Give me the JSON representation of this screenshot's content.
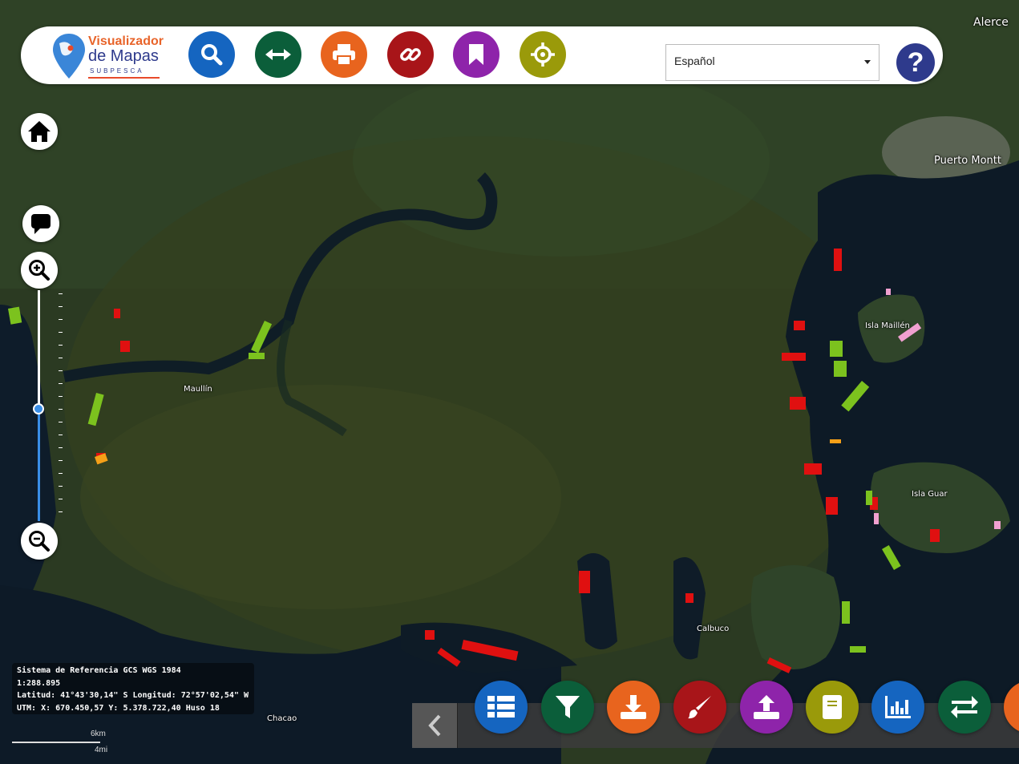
{
  "header": {
    "logo": {
      "line1": "Visualizador",
      "line2": "de Mapas",
      "line3": "SUBPESCA"
    },
    "tools": [
      {
        "name": "search",
        "icon": "search-icon",
        "color": "#1565c0"
      },
      {
        "name": "measure",
        "icon": "arrows-horizontal-icon",
        "color": "#0b5e3a"
      },
      {
        "name": "print",
        "icon": "printer-icon",
        "color": "#e8641e"
      },
      {
        "name": "share-link",
        "icon": "link-icon",
        "color": "#a81519"
      },
      {
        "name": "bookmark",
        "icon": "bookmark-icon",
        "color": "#8e24aa"
      },
      {
        "name": "locate",
        "icon": "crosshair-icon",
        "color": "#9a9a0a"
      }
    ],
    "language": {
      "selected": "Español"
    },
    "help": {
      "label": "?",
      "color": "#2e3a8c"
    }
  },
  "map_controls": {
    "home": "home-icon",
    "comment": "comment-icon",
    "zoom_in": "zoom-in-icon",
    "zoom_out": "zoom-out-icon",
    "zoom_level_fraction": 0.48
  },
  "place_labels": {
    "alerce": "Alerce",
    "puerto_montt": "Puerto Montt",
    "isla_maillen": "Isla Maillén",
    "maullin": "Maullín",
    "isla_guar": "Isla Guar",
    "calbuco": "Calbuco",
    "chacao": "Chacao"
  },
  "coordinates": {
    "line1": "Sistema de Referencia GCS WGS 1984",
    "line2": "1:288.895",
    "line3": "Latitud: 41°43'30,14\" S  Longitud: 72°57'02,54\" W",
    "line4": "UTM: X: 670.450,57  Y: 5.378.722,40  Huso 18"
  },
  "scale": {
    "km": "6km",
    "mi": "4mi"
  },
  "bottom_tools": [
    {
      "name": "layers-list",
      "icon": "table-list-icon",
      "color": "#1565c0"
    },
    {
      "name": "filter",
      "icon": "filter-icon",
      "color": "#0b5e3a"
    },
    {
      "name": "download",
      "icon": "download-icon",
      "color": "#e8641e"
    },
    {
      "name": "draw",
      "icon": "paintbrush-icon",
      "color": "#a81519"
    },
    {
      "name": "upload",
      "icon": "upload-icon",
      "color": "#8e24aa"
    },
    {
      "name": "book",
      "icon": "book-icon",
      "color": "#9a9a0a"
    },
    {
      "name": "chart",
      "icon": "bar-chart-icon",
      "color": "#1565c0"
    },
    {
      "name": "swap",
      "icon": "swap-icon",
      "color": "#0b5e3a"
    },
    {
      "name": "more",
      "icon": "more-icon",
      "color": "#e8641e"
    }
  ]
}
